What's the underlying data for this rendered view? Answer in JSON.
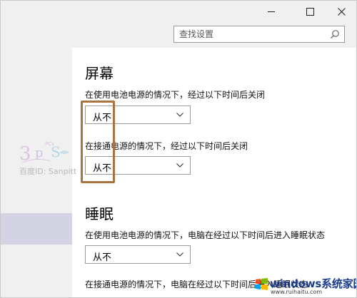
{
  "search": {
    "placeholder": "查找设置"
  },
  "screen": {
    "title": "屏幕",
    "battery_label": "在使用电池电源的情况下，经过以下时间后关闭",
    "battery_value": "从不",
    "plugged_label": "在接通电源的情况下，经过以下时间后关闭",
    "plugged_value": "从不"
  },
  "sleep": {
    "title": "睡眠",
    "battery_label": "在使用电池电源的情况下，电脑在经过以下时间后进入睡眠状态",
    "battery_value": "从不",
    "plugged_label": "在接通电源的情况下，电脑在经过以下时间后进入睡眠状态"
  },
  "watermark": {
    "text": "百度ID: Sanpitt"
  },
  "logo": {
    "brand": "windows系统家园",
    "url": "www.ruihaitu.com"
  },
  "colors": {
    "highlight": "#a9743e",
    "sidebar_selected": "#d3d3e3",
    "window_bg": "#f0f0f0",
    "content_bg": "#ffffff"
  }
}
